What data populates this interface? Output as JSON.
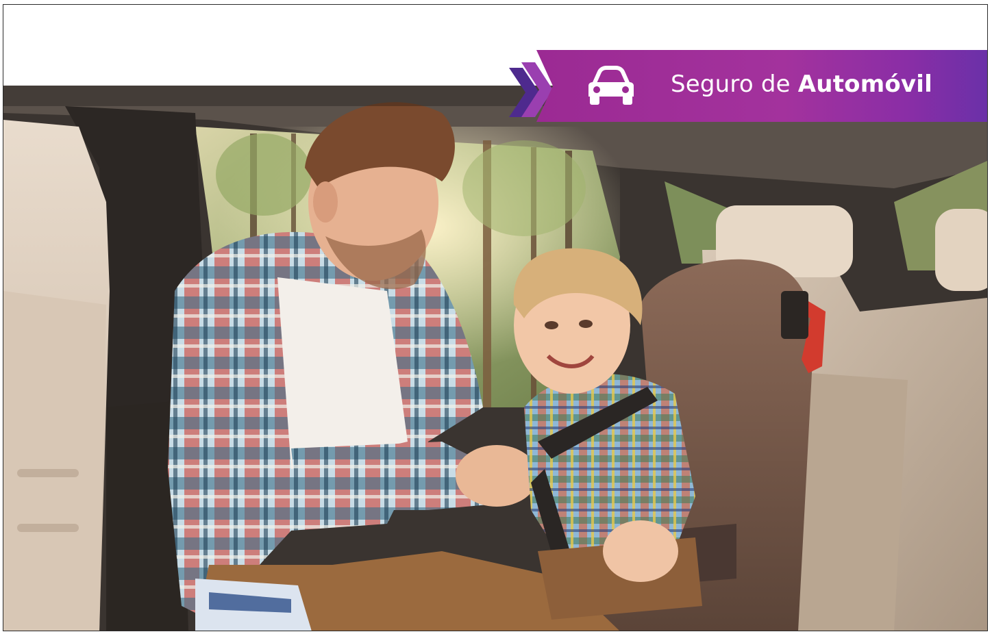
{
  "banner": {
    "prefix": "Seguro de",
    "emphasis": "Automóvil",
    "icon": "car-icon",
    "chevron_icon": "double-chevron-right-icon"
  },
  "photo": {
    "subject": "father-fastening-child-car-seat"
  },
  "colors": {
    "banner_start": "#9b2a93",
    "banner_end": "#6a30a8",
    "chevron_light": "#9a3fb0",
    "chevron_dark": "#4e2a8e",
    "icon": "#ffffff"
  }
}
